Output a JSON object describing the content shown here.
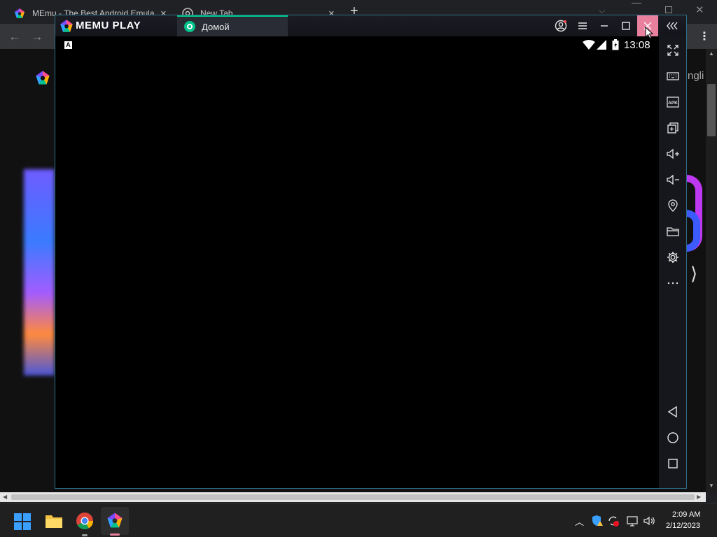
{
  "browser": {
    "tabs": [
      {
        "title": "MEmu - The Best Android Emula",
        "close": "✕"
      },
      {
        "title": "New Tab",
        "close": "✕"
      }
    ],
    "new_tab": "+",
    "page_fragment": "ngli"
  },
  "memu": {
    "logo": "MEMU PLAY",
    "tab_label": "Домой",
    "status": {
      "keyboard_badge": "A",
      "time": "13:08"
    },
    "colors": {
      "close_hover": "#e9809e",
      "accent": "#00c389"
    }
  },
  "taskbar": {
    "time": "2:09 AM",
    "date": "2/12/2023"
  }
}
